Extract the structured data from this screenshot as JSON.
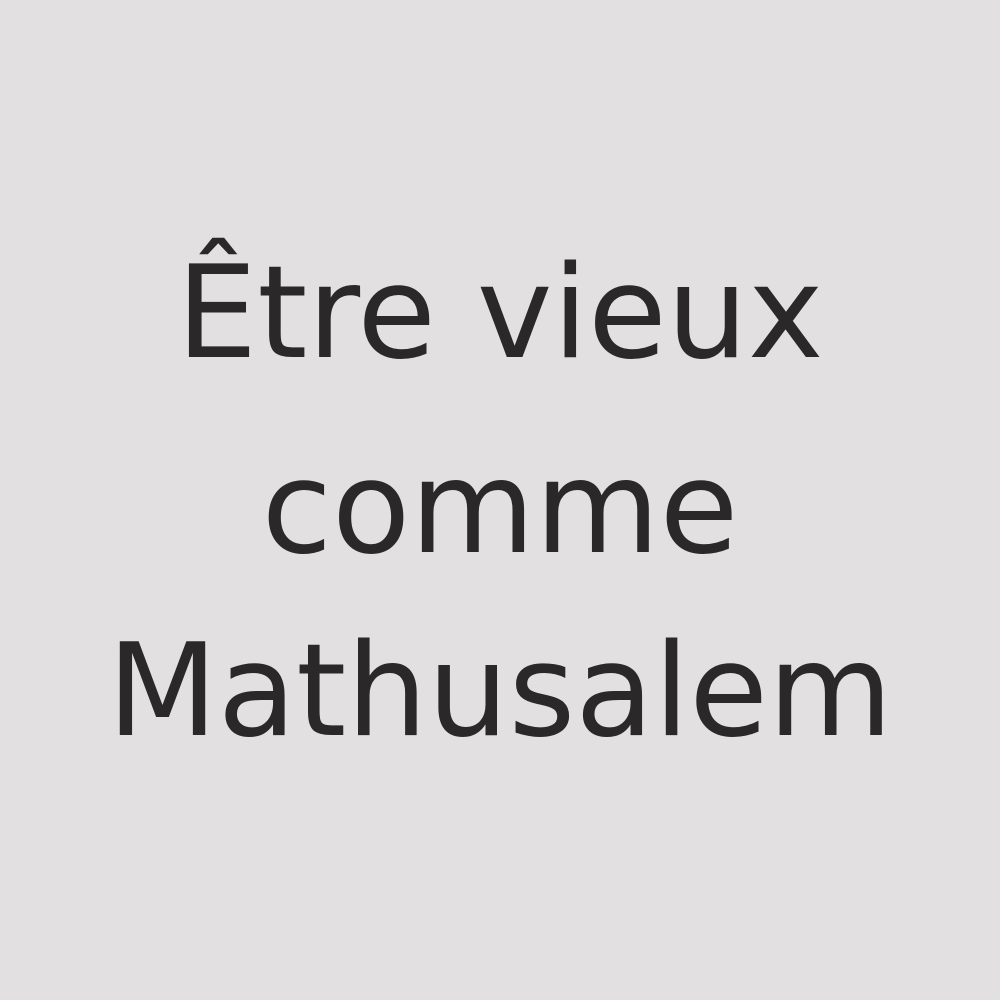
{
  "card": {
    "background_color": "#e2e0e1",
    "text_color": "#2b2829",
    "lines": [
      "Être vieux",
      "comme",
      "Mathusalem"
    ]
  }
}
